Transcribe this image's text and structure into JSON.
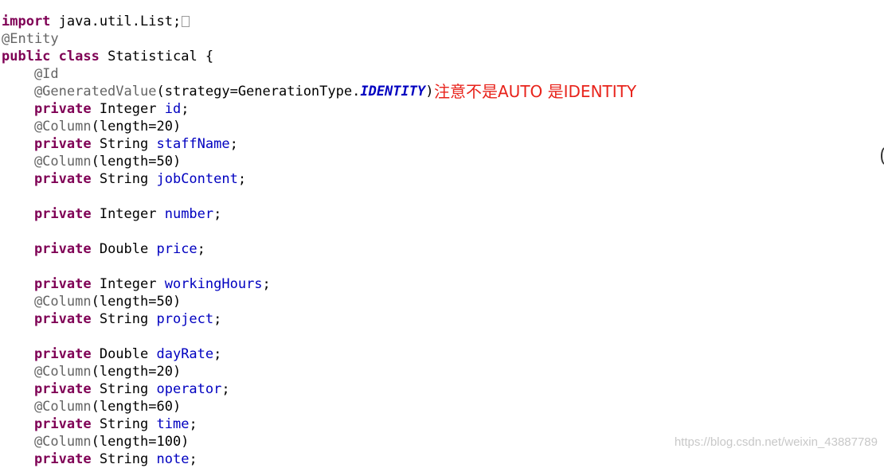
{
  "lines": [
    {
      "k1": "import",
      "t1": " java.util.List;",
      "fold": true
    },
    {
      "a": "@Entity"
    },
    {
      "k1": "public",
      "t1": " ",
      "k2": "class",
      "t2": " Statistical {"
    },
    {
      "a": "    @Id"
    },
    {
      "a": "    @GeneratedValue",
      "p": "(strategy=GenerationType.",
      "c": "IDENTITY",
      "s": ")"
    },
    {
      "k1": "    private",
      "t1": " Integer ",
      "f": "id",
      "s": ";"
    },
    {
      "a": "    @Column",
      "p": "(length=20)"
    },
    {
      "k1": "    private",
      "t1": " String ",
      "f": "staffName",
      "s": ";"
    },
    {
      "a": "    @Column",
      "p": "(length=50)"
    },
    {
      "k1": "    private",
      "t1": " String ",
      "f": "jobContent",
      "s": ";"
    },
    {},
    {
      "k1": "    private",
      "t1": " Integer ",
      "f": "number",
      "s": ";"
    },
    {},
    {
      "k1": "    private",
      "t1": " Double ",
      "f": "price",
      "s": ";"
    },
    {},
    {
      "k1": "    private",
      "t1": " Integer ",
      "f": "workingHours",
      "s": ";"
    },
    {
      "a": "    @Column",
      "p": "(length=50)"
    },
    {
      "k1": "    private",
      "t1": " String ",
      "f": "project",
      "s": ";"
    },
    {},
    {
      "k1": "    private",
      "t1": " Double ",
      "f": "dayRate",
      "s": ";"
    },
    {
      "a": "    @Column",
      "p": "(length=20)"
    },
    {
      "k1": "    private",
      "t1": " String ",
      "f": "operator",
      "s": ";"
    },
    {
      "a": "    @Column",
      "p": "(length=60)"
    },
    {
      "k1": "    private",
      "t1": " String ",
      "f": "time",
      "s": ";"
    },
    {
      "a": "    @Column",
      "p": "(length=100)"
    },
    {
      "k1": "    private",
      "t1": " String ",
      "f": "note",
      "s": ";"
    }
  ],
  "annotation_note": "注意不是AUTO 是IDENTITY",
  "watermark": "https://blog.csdn.net/weixin_43887789"
}
